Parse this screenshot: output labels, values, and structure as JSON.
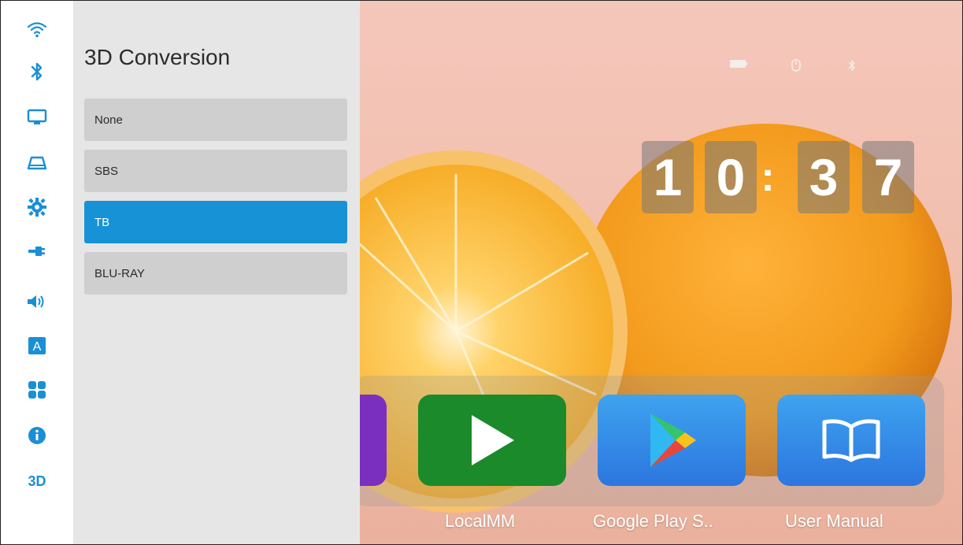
{
  "panel": {
    "title": "3D Conversion",
    "options": [
      {
        "label": "None",
        "selected": false
      },
      {
        "label": "SBS",
        "selected": false
      },
      {
        "label": "TB",
        "selected": true
      },
      {
        "label": "BLU-RAY",
        "selected": false
      }
    ]
  },
  "sidebar": {
    "items": [
      {
        "name": "wifi-icon"
      },
      {
        "name": "bluetooth-icon"
      },
      {
        "name": "display-icon"
      },
      {
        "name": "projection-icon"
      },
      {
        "name": "settings-gear-icon"
      },
      {
        "name": "input-source-icon"
      },
      {
        "name": "speaker-icon"
      },
      {
        "name": "language-icon",
        "text": "A"
      },
      {
        "name": "apps-grid-icon"
      },
      {
        "name": "info-icon"
      },
      {
        "name": "3d-icon",
        "text": "3D"
      }
    ]
  },
  "clock": {
    "h1": "1",
    "h2": "0",
    "sep": ":",
    "m1": "3",
    "m2": "7"
  },
  "status_icons": [
    "battery-icon",
    "mouse-icon",
    "bluetooth-status-icon"
  ],
  "apps": [
    {
      "name": "LocalMM",
      "color": "#1b8a2a"
    },
    {
      "name": "Google Play S..",
      "color": "#2f86e6"
    },
    {
      "name": "User Manual",
      "color": "#2f86e6"
    }
  ],
  "colors": {
    "accent": "#1892d6",
    "rail_icon": "#1a8fd6",
    "panel_bg": "#e6e6e6",
    "option_bg": "#cfcfcf"
  }
}
